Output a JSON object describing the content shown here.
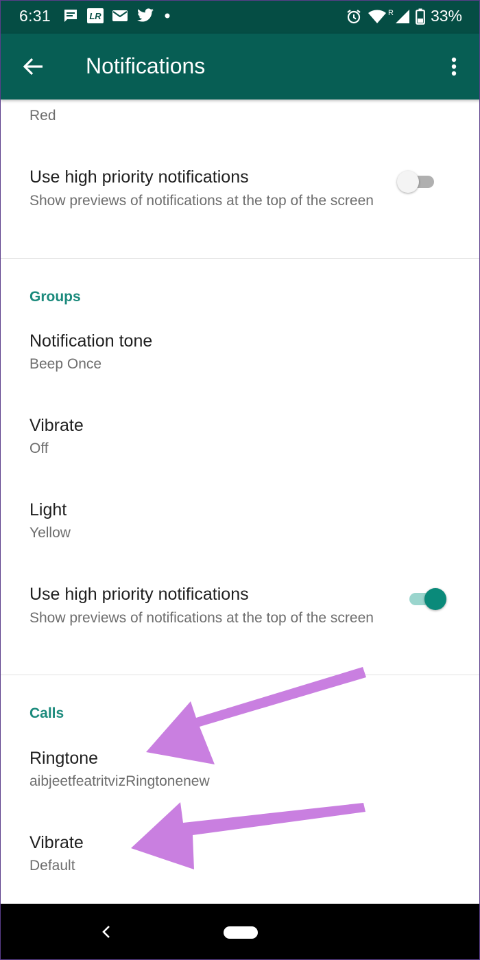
{
  "status_bar": {
    "time": "6:31",
    "battery": "33%",
    "icons_left": [
      "message-icon",
      "lr-icon",
      "mail-icon",
      "twitter-icon",
      "dot-icon"
    ],
    "icons_right": [
      "alarm-icon",
      "wifi-icon",
      "signal-icon",
      "battery-icon"
    ],
    "lr_text": "LR",
    "roaming_mark": "R"
  },
  "app_bar": {
    "title": "Notifications",
    "back_icon": "arrow-back-icon",
    "menu_icon": "more-vert-icon",
    "background": "#075e54"
  },
  "messages_partial": {
    "light_value": "Red",
    "high_priority": {
      "title": "Use high priority notifications",
      "subtitle": "Show previews of notifications at the top of the screen",
      "enabled": false
    }
  },
  "groups": {
    "header": "Groups",
    "notification_tone": {
      "title": "Notification tone",
      "value": "Beep Once"
    },
    "vibrate": {
      "title": "Vibrate",
      "value": "Off"
    },
    "light": {
      "title": "Light",
      "value": "Yellow"
    },
    "high_priority": {
      "title": "Use high priority notifications",
      "subtitle": "Show previews of notifications at the top of the screen",
      "enabled": true
    }
  },
  "calls": {
    "header": "Calls",
    "ringtone": {
      "title": "Ringtone",
      "value": "aibjeetfeatritvizRingtonenew"
    },
    "vibrate": {
      "title": "Vibrate",
      "value": "Default"
    }
  },
  "colors": {
    "accent": "#1b8a7c",
    "annotation_arrow": "#c97fe0"
  }
}
